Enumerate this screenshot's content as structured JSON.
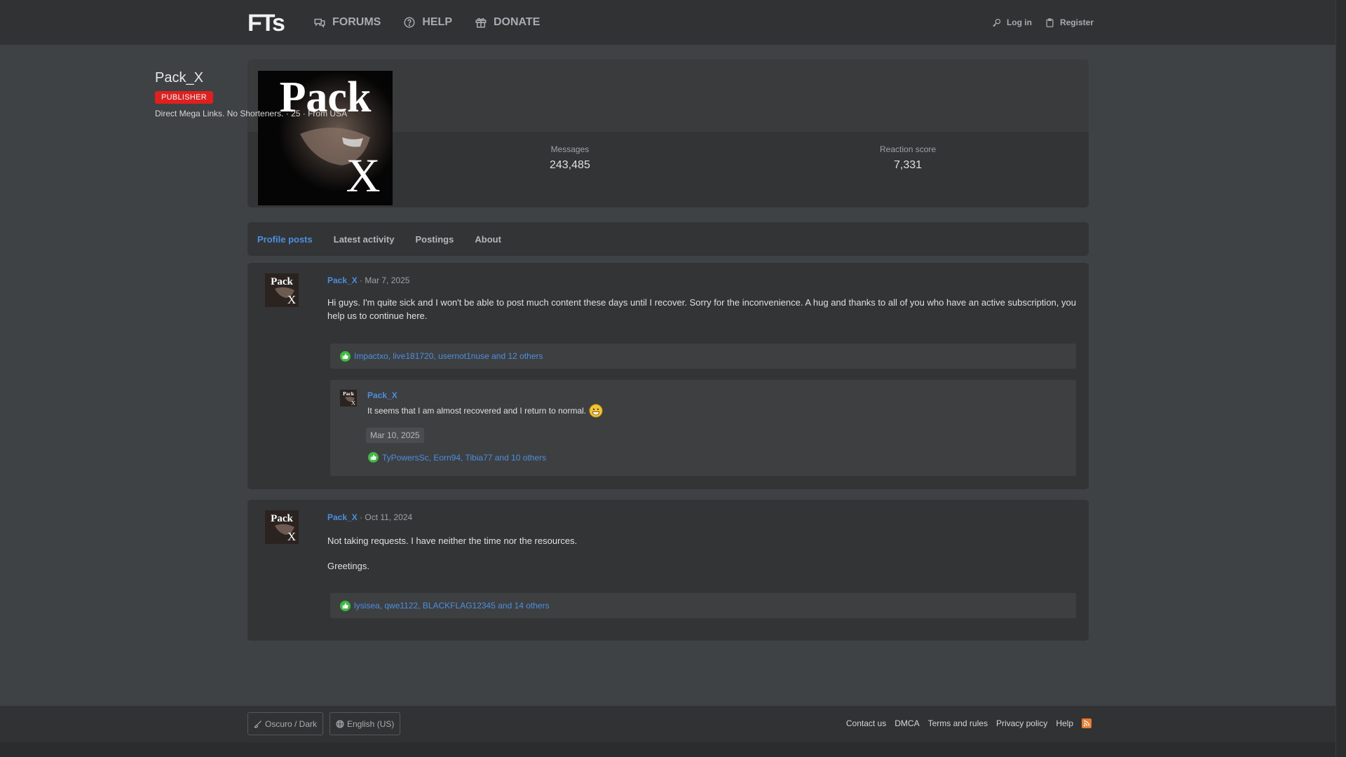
{
  "header": {
    "logo_text": "FTs",
    "nav": [
      {
        "label": "FORUMS",
        "icon": "comments-icon"
      },
      {
        "label": "HELP",
        "icon": "question-circle-icon"
      },
      {
        "label": "DONATE",
        "icon": "gift-icon"
      }
    ],
    "login_label": "Log in",
    "register_label": "Register"
  },
  "profile": {
    "name": "Pack_X",
    "avatar_text_top": "Pack",
    "avatar_text_bottom": "X",
    "badge": "PUBLISHER",
    "meta": "Direct Mega Links. No Shorteners. · 25 · From USA",
    "messages_label": "Messages",
    "messages_value": "243,485",
    "reaction_label": "Reaction score",
    "reaction_value": "7,331"
  },
  "tabs": [
    {
      "label": "Profile posts",
      "active": true
    },
    {
      "label": "Latest activity",
      "active": false
    },
    {
      "label": "Postings",
      "active": false
    },
    {
      "label": "About",
      "active": false
    }
  ],
  "posts": [
    {
      "author": "Pack_X",
      "date": "· Mar 7, 2025",
      "body": "Hi guys. I'm quite sick and I won't be able to post much content these days until I recover. Sorry for the inconvenience. A hug and thanks to all of you who have an active subscription, you help us to continue here.",
      "reactions": "Impactxo, live181720, usernot1nuse and 12 others",
      "comment": {
        "author": "Pack_X",
        "text": "It seems that I am almost recovered and I return to normal.",
        "date": "Mar 10, 2025",
        "reactions": "TyPowersSc, Eorn94, Tibia77 and 10 others"
      }
    },
    {
      "author": "Pack_X",
      "date": "· Oct 11, 2024",
      "body1": "Not taking requests. I have neither the time nor the resources.",
      "body2": "Greetings.",
      "reactions": "lysisea, qwe1122, BLACKFLAG12345 and 14 others"
    }
  ],
  "footer": {
    "style_label": "Oscuro / Dark",
    "language_label": "English (US)",
    "links": [
      "Contact us",
      "DMCA",
      "Terms and rules",
      "Privacy policy",
      "Help"
    ]
  },
  "colors": {
    "accent": "#4c8fe0",
    "badge": "#e01f1f",
    "like": "#3fba3f",
    "rss": "#e87b2e"
  }
}
